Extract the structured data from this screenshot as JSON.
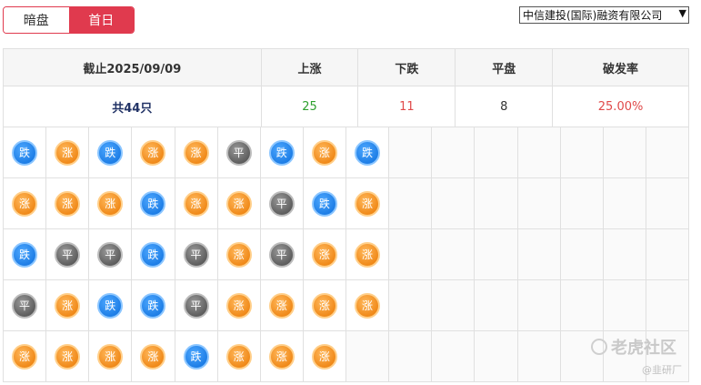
{
  "tabs": [
    {
      "label": "暗盘",
      "active": false
    },
    {
      "label": "首日",
      "active": true
    }
  ],
  "broker_select": {
    "selected": "中信建投(国际)融资有限公司"
  },
  "summary": {
    "headers": [
      "截止2025/09/09",
      "上涨",
      "下跌",
      "平盘",
      "破发率"
    ],
    "total": "共44只",
    "up": "25",
    "down": "11",
    "flat": "8",
    "break_rate": "25.00%"
  },
  "grid": {
    "columns": 16,
    "rows": [
      [
        "跌",
        "涨",
        "跌",
        "涨",
        "涨",
        "平",
        "跌",
        "涨",
        "跌"
      ],
      [
        "涨",
        "涨",
        "涨",
        "跌",
        "涨",
        "涨",
        "平",
        "跌",
        "涨"
      ],
      [
        "跌",
        "平",
        "平",
        "跌",
        "平",
        "涨",
        "平",
        "涨",
        "涨"
      ],
      [
        "平",
        "涨",
        "跌",
        "跌",
        "平",
        "涨",
        "涨",
        "涨",
        "涨"
      ],
      [
        "涨",
        "涨",
        "涨",
        "涨",
        "跌",
        "涨",
        "涨",
        "涨"
      ]
    ]
  },
  "status_colors": {
    "up": "#f08a1a",
    "down": "#1e7ee6",
    "flat": "#5e5e5e",
    "active_tab": "#e03a4e"
  },
  "watermark": {
    "brand": "老虎社区",
    "handle": "@韭研厂"
  }
}
